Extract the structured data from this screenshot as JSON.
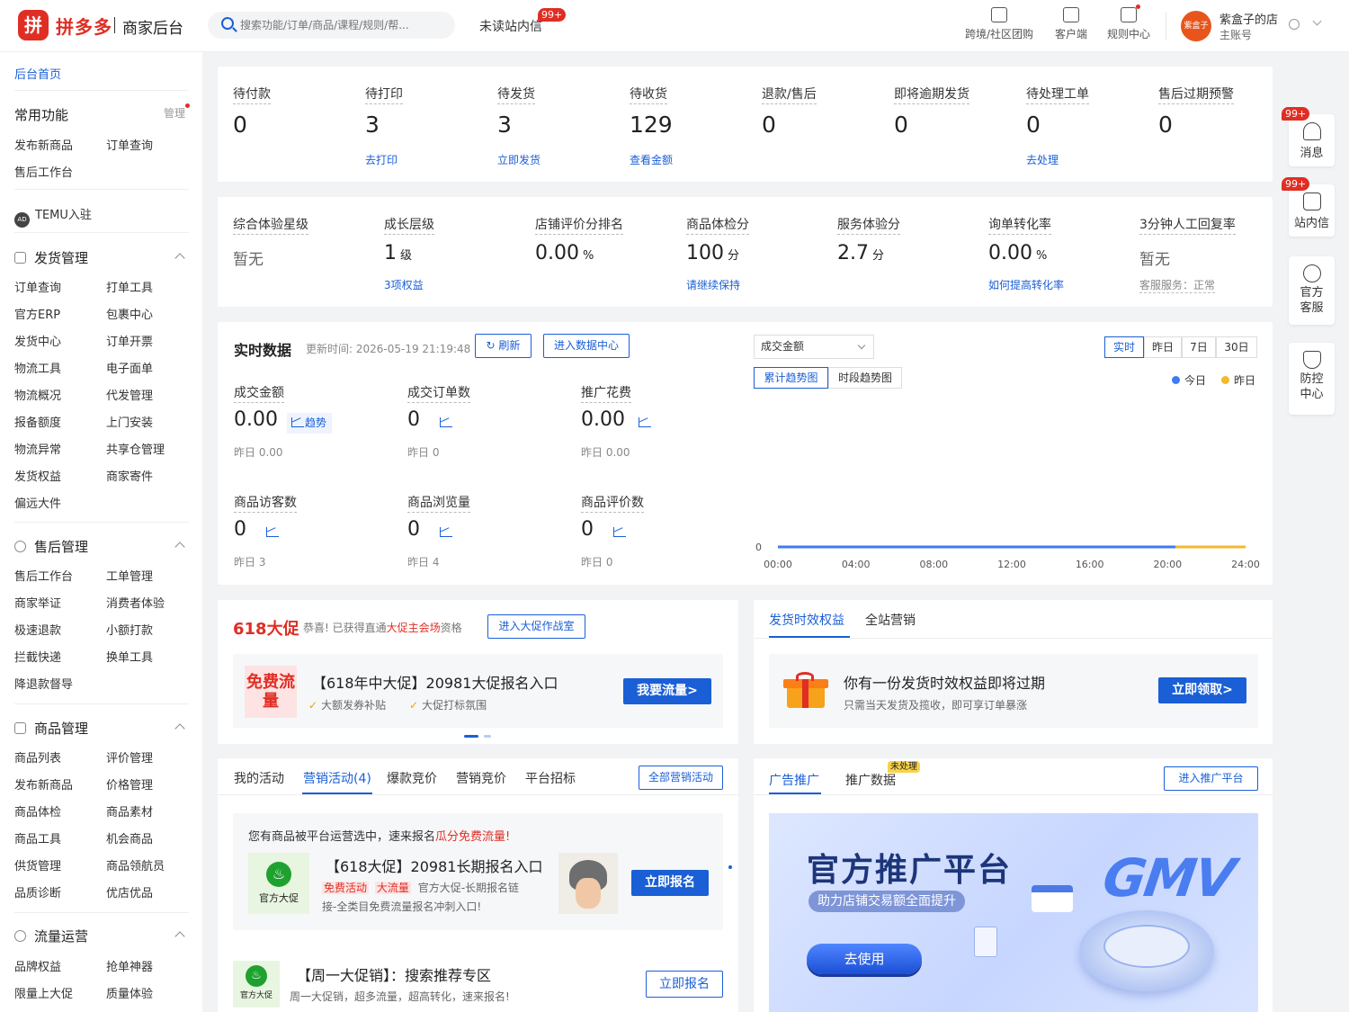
{
  "header": {
    "logo_icon": "拼",
    "brand": "拼多多",
    "subtitle": "商家后台",
    "search_placeholder": "搜索功能/订单/商品/课程/规则/帮...",
    "unread_label": "未读站内信",
    "unread_badge": "99+",
    "links": [
      "跨境/社区团购",
      "客户端",
      "规则中心"
    ],
    "avatar_text": "紫盒子",
    "store_name": "紫盒子的店",
    "store_sub": "主账号"
  },
  "sidebar": {
    "home": "后台首页",
    "common": {
      "title": "常用功能",
      "manage": "管理",
      "items": [
        "发布新商品",
        "订单查询",
        "售后工作台"
      ]
    },
    "temu": {
      "icon": "AD",
      "label": "TEMU入驻"
    },
    "shipping": {
      "title": "发货管理",
      "items": [
        "订单查询",
        "打单工具",
        "官方ERP",
        "包裹中心",
        "发货中心",
        "订单开票",
        "物流工具",
        "电子面单",
        "物流概况",
        "代发管理",
        "报备额度",
        "上门安装",
        "物流异常",
        "共享仓管理",
        "发货权益",
        "商家寄件",
        "偏远大件"
      ]
    },
    "aftersale": {
      "title": "售后管理",
      "items": [
        "售后工作台",
        "工单管理",
        "商家举证",
        "消费者体验",
        "极速退款",
        "小额打款",
        "拦截快递",
        "换单工具",
        "降退款督导"
      ]
    },
    "goods": {
      "title": "商品管理",
      "items": [
        "商品列表",
        "评价管理",
        "发布新商品",
        "价格管理",
        "商品体检",
        "商品素材",
        "商品工具",
        "机会商品",
        "供货管理",
        "商品领航员",
        "品质诊断",
        "优店优品"
      ]
    },
    "traffic": {
      "title": "流量运营",
      "items": [
        "品牌权益",
        "抢单神器",
        "限量上大促",
        "质量体验"
      ]
    }
  },
  "pending": [
    {
      "label": "待付款",
      "value": "0",
      "link": ""
    },
    {
      "label": "待打印",
      "value": "3",
      "link": "去打印"
    },
    {
      "label": "待发货",
      "value": "3",
      "link": "立即发货"
    },
    {
      "label": "待收货",
      "value": "129",
      "link": "查看金额"
    },
    {
      "label": "退款/售后",
      "value": "0",
      "link": ""
    },
    {
      "label": "即将逾期发货",
      "value": "0",
      "link": ""
    },
    {
      "label": "待处理工单",
      "value": "0",
      "link": "去处理"
    },
    {
      "label": "售后过期预警",
      "value": "0",
      "link": ""
    }
  ],
  "metrics": [
    {
      "label": "综合体验星级",
      "value": "暂无",
      "unit": "",
      "link": ""
    },
    {
      "label": "成长层级",
      "value": "1",
      "unit": "级",
      "link": "3项权益"
    },
    {
      "label": "店铺评价分排名",
      "value": "0.00",
      "unit": "%",
      "link": ""
    },
    {
      "label": "商品体检分",
      "value": "100",
      "unit": "分",
      "link": "请继续保持"
    },
    {
      "label": "服务体验分",
      "value": "2.7",
      "unit": "分",
      "link": ""
    },
    {
      "label": "询单转化率",
      "value": "0.00",
      "unit": "%",
      "link": "如何提高转化率"
    },
    {
      "label": "3分钟人工回复率",
      "value": "暂无",
      "unit": "",
      "link": "客服服务：正常"
    }
  ],
  "realtime": {
    "title": "实时数据",
    "updated": "更新时间: 2026-05-19 21:19:48",
    "refresh": "刷新",
    "enter": "进入数据中心",
    "trend_label": "趋势",
    "stats": [
      {
        "label": "成交金额",
        "value": "0.00",
        "yesterday": "昨日 0.00"
      },
      {
        "label": "成交订单数",
        "value": "0",
        "yesterday": "昨日 0"
      },
      {
        "label": "推广花费",
        "value": "0.00",
        "yesterday": "昨日 0.00"
      },
      {
        "label": "商品访客数",
        "value": "0",
        "yesterday": "昨日 3"
      },
      {
        "label": "商品浏览量",
        "value": "0",
        "yesterday": "昨日 4"
      },
      {
        "label": "商品评价数",
        "value": "0",
        "yesterday": "昨日 0"
      }
    ],
    "select": "成交金额",
    "ranges": [
      "实时",
      "昨日",
      "7日",
      "30日"
    ],
    "chart_tabs": [
      "累计趋势图",
      "时段趋势图"
    ],
    "legend": [
      "今日",
      "昨日"
    ]
  },
  "chart_data": {
    "type": "line",
    "x": [
      "00:00",
      "04:00",
      "08:00",
      "12:00",
      "16:00",
      "20:00",
      "24:00"
    ],
    "series": [
      {
        "name": "今日",
        "color": "#3d7bf2",
        "values": [
          0,
          0,
          0,
          0,
          0,
          0
        ]
      },
      {
        "name": "昨日",
        "color": "#f5b82e",
        "values": [
          0,
          0,
          0,
          0,
          0,
          0,
          0
        ]
      }
    ],
    "y_tick": "0",
    "today_end_fraction": 0.85
  },
  "promo618": {
    "title": "618大促",
    "text_a": "恭喜! 已获得直通",
    "text_b": "大促主会场",
    "text_c": "资格",
    "button": "进入大促作战室",
    "badge": "免费流量",
    "headline": "【618年中大促】20981大促报名入口",
    "check1": "大额发券补贴",
    "check2": "大促打标氛围",
    "cta": "我要流量>"
  },
  "benefit": {
    "tabs": [
      "发货时效权益",
      "全站营销"
    ],
    "title": "你有一份发货时效权益即将过期",
    "desc": "只需当天发货及揽收，即可享订单暴涨",
    "cta": "立即领取>"
  },
  "activities": {
    "tabs": [
      "我的活动",
      "营销活动(4)",
      "爆款竞价",
      "营销竞价",
      "平台招标"
    ],
    "all_button": "全部营销活动",
    "notice_a": "您有商品被平台运营选中，速来报名",
    "notice_b": "瓜分免费流量!",
    "item1": {
      "badge": "官方大促",
      "title": "【618大促】20981长期报名入口",
      "tag1": "免费活动",
      "tag2": "大流量",
      "desc1": "官方大促-长期报名链",
      "desc2": "接-全类目免费流量报名冲刺入口!",
      "cta": "立即报名"
    },
    "item2": {
      "badge": "官方大促",
      "title": "【周一大促销】：搜索推荐专区",
      "desc": "周一大促销，超多流量，超高转化，速来报名!",
      "cta": "立即报名"
    }
  },
  "ads": {
    "tabs": [
      "广告推广",
      "推广数据"
    ],
    "new_tag": "未处理",
    "enter": "进入推广平台",
    "banner_title": "官方推广平台",
    "banner_sub": "助力店铺交易额全面提升",
    "banner_cta": "去使用",
    "banner_art": "GMV"
  },
  "float": [
    {
      "label": "消息",
      "badge": "99+"
    },
    {
      "label": "站内信",
      "badge": "99+"
    },
    {
      "label": "官方客服",
      "badge": ""
    },
    {
      "label": "防控中心",
      "badge": ""
    }
  ]
}
